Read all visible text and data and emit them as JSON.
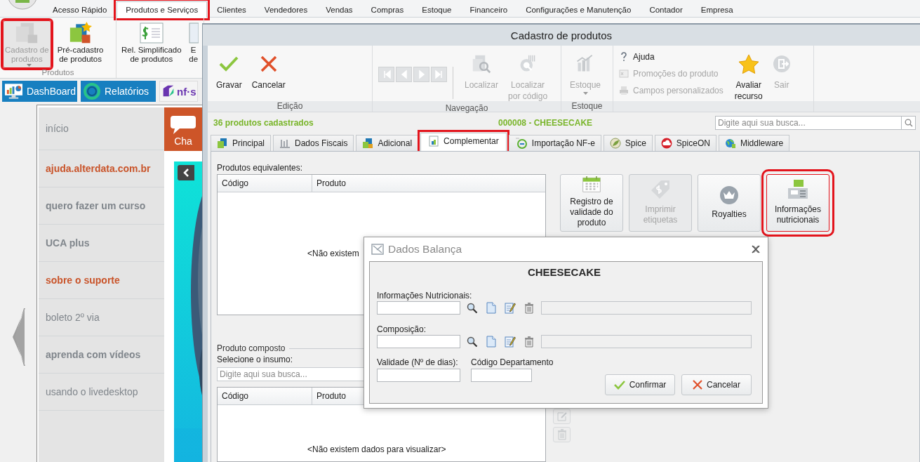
{
  "app": {
    "ribbon_tabs": [
      {
        "label": "Acesso Rápido",
        "selected": false,
        "highlighted": false
      },
      {
        "label": "Produtos e Serviços",
        "selected": true,
        "highlighted": true
      },
      {
        "label": "Clientes",
        "selected": false,
        "highlighted": false
      },
      {
        "label": "Vendedores",
        "selected": false,
        "highlighted": false
      },
      {
        "label": "Vendas",
        "selected": false,
        "highlighted": false
      },
      {
        "label": "Compras",
        "selected": false,
        "highlighted": false
      },
      {
        "label": "Estoque",
        "selected": false,
        "highlighted": false
      },
      {
        "label": "Financeiro",
        "selected": false,
        "highlighted": false
      },
      {
        "label": "Configurações e Manutenção",
        "selected": false,
        "highlighted": false
      },
      {
        "label": "Contador",
        "selected": false,
        "highlighted": false
      },
      {
        "label": "Empresa",
        "selected": false,
        "highlighted": false
      }
    ],
    "ribbon_groups": [
      {
        "label": "Produtos",
        "buttons": [
          {
            "label": "Cadastro de\nprodutos",
            "disabled": true,
            "highlighted": true,
            "dropdown": true
          },
          {
            "label": "Pré-cadastro\nde produtos",
            "disabled": false,
            "highlighted": false,
            "dropdown": false
          }
        ]
      },
      {
        "buttons": [
          {
            "label": "Rel. Simplificado\nde produtos",
            "disabled": false,
            "highlighted": false,
            "dropdown": false
          },
          {
            "label": "E\nde",
            "disabled": false,
            "highlighted": false,
            "dropdown": false
          }
        ]
      }
    ],
    "quick_links": [
      {
        "label": "DashBoard"
      },
      {
        "label": "Relatórios"
      },
      {
        "label": "nf·s"
      }
    ],
    "sidebar": {
      "items": [
        {
          "label": "início",
          "bold": false,
          "color": "#80868c"
        },
        {
          "label": "ajuda.alterdata.com.br",
          "bold": true,
          "color": "#c9542a"
        },
        {
          "label": "quero fazer um curso",
          "bold": true,
          "color": "#80868c"
        },
        {
          "label": "UCA plus",
          "bold": true,
          "color": "#80868c"
        },
        {
          "label": "sobre o suporte",
          "bold": true,
          "color": "#c9542a"
        },
        {
          "label": "boleto 2º via",
          "bold": false,
          "color": "#80868c"
        },
        {
          "label": "aprenda com vídeos",
          "bold": true,
          "color": "#80868c"
        },
        {
          "label": "usando o livedesktop",
          "bold": false,
          "color": "#80868c"
        }
      ]
    },
    "chat_tile": {
      "label": "Cha"
    }
  },
  "product_window": {
    "title": "Cadastro de produtos",
    "ribbon_groups": [
      {
        "label": "Edição",
        "buttons": [
          {
            "kind": "large",
            "label": "Gravar",
            "disabled": false
          },
          {
            "kind": "large",
            "label": "Cancelar",
            "disabled": false
          }
        ]
      },
      {
        "label": "Navegação",
        "buttons": [
          {
            "kind": "pager",
            "disabled": true
          },
          {
            "kind": "pager",
            "disabled": true
          },
          {
            "kind": "pager",
            "disabled": true
          },
          {
            "kind": "pager",
            "disabled": true
          },
          {
            "kind": "large",
            "label": "Localizar",
            "disabled": true
          },
          {
            "kind": "large",
            "label": "Localizar\npor código",
            "disabled": true
          }
        ]
      },
      {
        "label": "Estoque",
        "buttons": [
          {
            "kind": "large",
            "label": "Estoque",
            "disabled": true,
            "dropdown": true
          }
        ]
      },
      {
        "buttons": [
          {
            "kind": "small",
            "label": "Ajuda",
            "disabled": false
          },
          {
            "kind": "small",
            "label": "Promoções do produto",
            "disabled": true
          },
          {
            "kind": "small",
            "label": "Campos personalizados",
            "disabled": true
          },
          {
            "kind": "large",
            "label": "Avaliar\nrecurso",
            "disabled": false
          },
          {
            "kind": "large",
            "label": "Sair",
            "disabled": true
          }
        ]
      }
    ],
    "record_count": "36 produtos cadastrados",
    "current_record": "000008 - CHEESECAKE",
    "search": {
      "placeholder": "Digite aqui sua busca..."
    },
    "tabs": [
      {
        "label": "Principal",
        "selected": false,
        "highlighted": false
      },
      {
        "label": "Dados Fiscais",
        "selected": false,
        "highlighted": false
      },
      {
        "label": "Adicional",
        "selected": false,
        "highlighted": false
      },
      {
        "label": "Complementar",
        "selected": true,
        "highlighted": true
      },
      {
        "label": "Importação NF-e",
        "selected": false,
        "highlighted": false
      },
      {
        "label": "Spice",
        "selected": false,
        "highlighted": false
      },
      {
        "label": "SpiceON",
        "selected": false,
        "highlighted": false
      },
      {
        "label": "Middleware",
        "selected": false,
        "highlighted": false
      }
    ],
    "equivalents": {
      "label": "Produtos equivalentes:",
      "columns": [
        "Código",
        "Produto"
      ],
      "empty_message": "<Não existem"
    },
    "actions": [
      {
        "label": "Registro de\nvalidade do\nproduto",
        "disabled": false,
        "highlighted": false
      },
      {
        "label": "Imprimir\netiquetas",
        "disabled": true,
        "highlighted": false
      },
      {
        "label": "Royalties",
        "disabled": false,
        "highlighted": false
      },
      {
        "label": "Informações\nnutricionais",
        "disabled": false,
        "highlighted": true
      }
    ],
    "composite": {
      "title": "Produto composto",
      "input_label": "Selecione o insumo:",
      "search": {
        "placeholder": "Digite aqui sua busca..."
      },
      "columns": [
        "Código",
        "Produto"
      ],
      "empty_message": "<Não existem dados para visualizar>",
      "side_buttons": [
        {
          "disabled": true
        },
        {
          "disabled": true
        }
      ]
    }
  },
  "dialog": {
    "title": "Dados Balança",
    "heading": "CHEESECAKE",
    "lookups": [
      {
        "label": "Informações Nutricionais:"
      },
      {
        "label": "Composição:"
      }
    ],
    "fields": [
      {
        "label": "Validade (Nº de dias):"
      },
      {
        "label": "Código Departamento"
      }
    ],
    "buttons": [
      {
        "kind": "confirm",
        "label": "Confirmar"
      },
      {
        "kind": "cancel",
        "label": "Cancelar"
      }
    ]
  }
}
